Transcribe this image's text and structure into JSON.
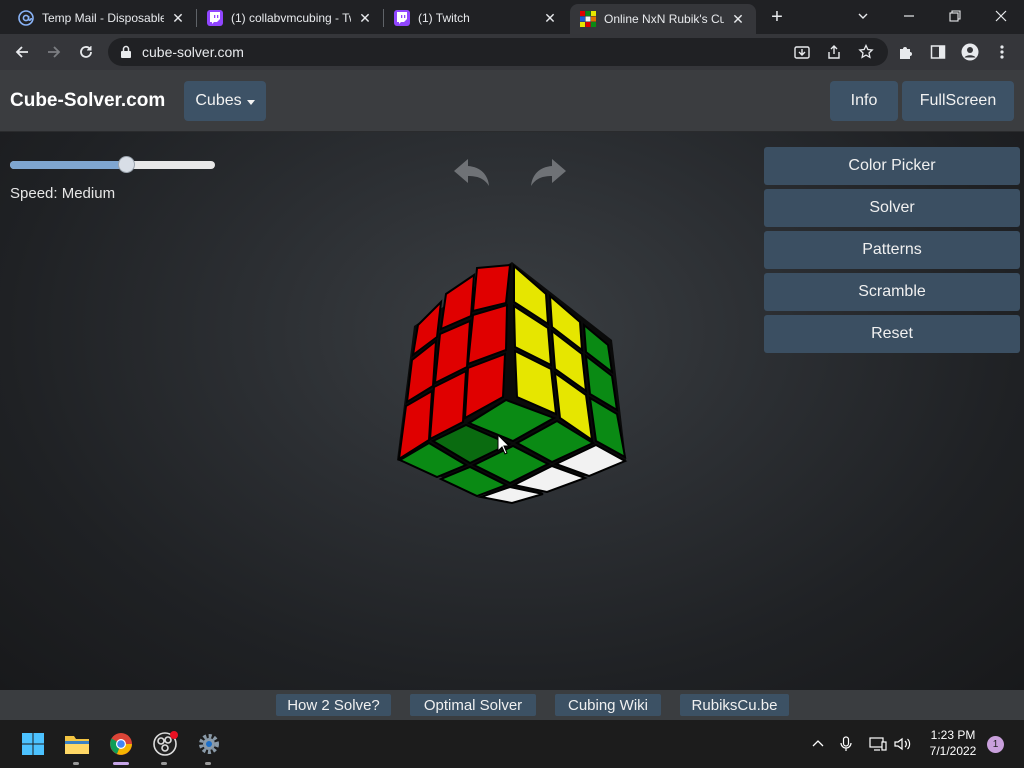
{
  "browser": {
    "tabs": [
      {
        "title": "Temp Mail - Disposable",
        "icon": "at-icon"
      },
      {
        "title": "(1) collabvmcubing - Tw",
        "icon": "twitch-icon"
      },
      {
        "title": "(1) Twitch",
        "icon": "twitch-icon"
      },
      {
        "title": "Online NxN Rubik's Cu",
        "icon": "rubik-icon"
      }
    ],
    "url": "cube-solver.com"
  },
  "site": {
    "brand": "Cube-Solver.com",
    "cubes_label": "Cubes",
    "info_label": "Info",
    "fullscreen_label": "FullScreen",
    "speed_label": "Speed: Medium",
    "speed_value": 0.57,
    "side_buttons": [
      "Color Picker",
      "Solver",
      "Patterns",
      "Scramble",
      "Reset"
    ],
    "footer_links": [
      "How 2 Solve?",
      "Optimal Solver",
      "Cubing Wiki",
      "RubiksCu.be"
    ]
  },
  "colors": {
    "red": "#e00000",
    "yellow": "#e6e600",
    "green": "#0a8a14",
    "white": "#f2f2f2",
    "button": "#3b4f62"
  },
  "taskbar": {
    "time": "1:23 PM",
    "date": "7/1/2022",
    "notifications": "1"
  }
}
